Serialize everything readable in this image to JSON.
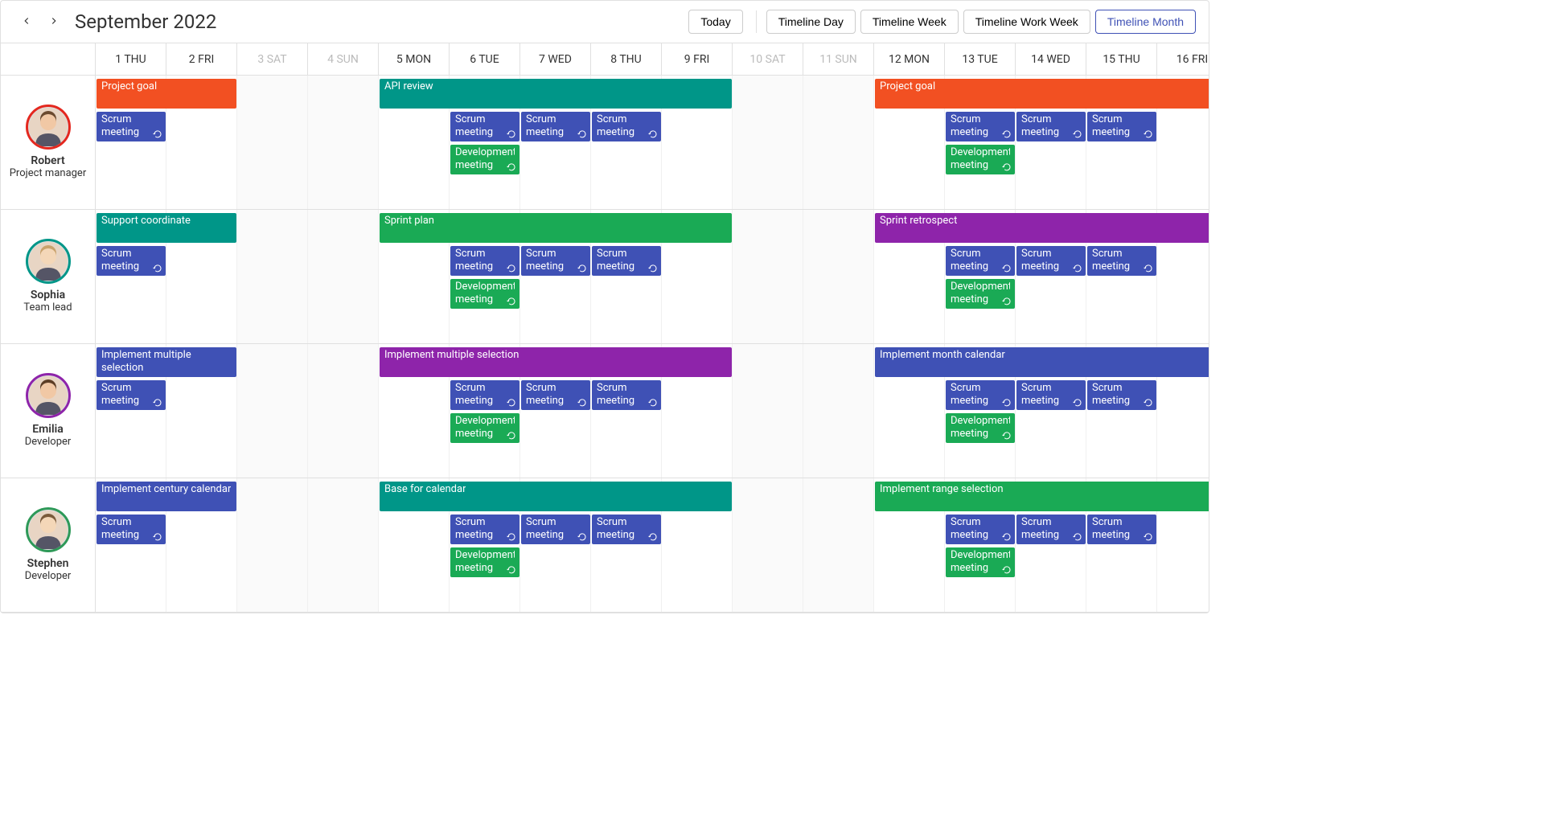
{
  "header": {
    "title": "September 2022",
    "today_label": "Today",
    "views": [
      {
        "label": "Timeline Day",
        "active": false
      },
      {
        "label": "Timeline Week",
        "active": false
      },
      {
        "label": "Timeline Work Week",
        "active": false
      },
      {
        "label": "Timeline Month",
        "active": true
      }
    ]
  },
  "dates": [
    {
      "day": 1,
      "dow": "THU",
      "weekend": false
    },
    {
      "day": 2,
      "dow": "FRI",
      "weekend": false
    },
    {
      "day": 3,
      "dow": "SAT",
      "weekend": true
    },
    {
      "day": 4,
      "dow": "SUN",
      "weekend": true
    },
    {
      "day": 5,
      "dow": "MON",
      "weekend": false
    },
    {
      "day": 6,
      "dow": "TUE",
      "weekend": false
    },
    {
      "day": 7,
      "dow": "WED",
      "weekend": false
    },
    {
      "day": 8,
      "dow": "THU",
      "weekend": false
    },
    {
      "day": 9,
      "dow": "FRI",
      "weekend": false
    },
    {
      "day": 10,
      "dow": "SAT",
      "weekend": true
    },
    {
      "day": 11,
      "dow": "SUN",
      "weekend": true
    },
    {
      "day": 12,
      "dow": "MON",
      "weekend": false
    },
    {
      "day": 13,
      "dow": "TUE",
      "weekend": false
    },
    {
      "day": 14,
      "dow": "WED",
      "weekend": false
    },
    {
      "day": 15,
      "dow": "THU",
      "weekend": false
    },
    {
      "day": 16,
      "dow": "FRI",
      "weekend": false
    }
  ],
  "resources": [
    {
      "name": "Robert",
      "role": "Project manager",
      "color": "#e4281f"
    },
    {
      "name": "Sophia",
      "role": "Team lead",
      "color": "#009688"
    },
    {
      "name": "Emilia",
      "role": "Developer",
      "color": "#8e24aa"
    },
    {
      "name": "Stephen",
      "role": "Developer",
      "color": "#2e9958"
    }
  ],
  "events": {
    "robert": [
      {
        "label": "Project goal",
        "start": 1,
        "end": 2,
        "row": 0,
        "color": "#f25022",
        "recur": false
      },
      {
        "label": "Scrum meeting",
        "start": 1,
        "end": 1,
        "row": 1,
        "color": "#3f51b5",
        "recur": true
      },
      {
        "label": "API review",
        "start": 5,
        "end": 9,
        "row": 0,
        "color": "#009688",
        "recur": false
      },
      {
        "label": "Scrum meeting",
        "start": 6,
        "end": 6,
        "row": 1,
        "color": "#3f51b5",
        "recur": true
      },
      {
        "label": "Scrum meeting",
        "start": 7,
        "end": 7,
        "row": 1,
        "color": "#3f51b5",
        "recur": true
      },
      {
        "label": "Scrum meeting",
        "start": 8,
        "end": 8,
        "row": 1,
        "color": "#3f51b5",
        "recur": true
      },
      {
        "label": "Development meeting",
        "start": 6,
        "end": 6,
        "row": 2,
        "color": "#1aaa55",
        "recur": true
      },
      {
        "label": "Project goal",
        "start": 12,
        "end": 16,
        "row": 0,
        "color": "#f25022",
        "recur": false,
        "openend": true
      },
      {
        "label": "Scrum meeting",
        "start": 13,
        "end": 13,
        "row": 1,
        "color": "#3f51b5",
        "recur": true
      },
      {
        "label": "Scrum meeting",
        "start": 14,
        "end": 14,
        "row": 1,
        "color": "#3f51b5",
        "recur": true
      },
      {
        "label": "Scrum meeting",
        "start": 15,
        "end": 15,
        "row": 1,
        "color": "#3f51b5",
        "recur": true
      },
      {
        "label": "Development meeting",
        "start": 13,
        "end": 13,
        "row": 2,
        "color": "#1aaa55",
        "recur": true
      }
    ],
    "sophia": [
      {
        "label": "Support coordinate",
        "start": 1,
        "end": 2,
        "row": 0,
        "color": "#009688",
        "recur": false
      },
      {
        "label": "Scrum meeting",
        "start": 1,
        "end": 1,
        "row": 1,
        "color": "#3f51b5",
        "recur": true
      },
      {
        "label": "Sprint plan",
        "start": 5,
        "end": 9,
        "row": 0,
        "color": "#1aaa55",
        "recur": false
      },
      {
        "label": "Scrum meeting",
        "start": 6,
        "end": 6,
        "row": 1,
        "color": "#3f51b5",
        "recur": true
      },
      {
        "label": "Scrum meeting",
        "start": 7,
        "end": 7,
        "row": 1,
        "color": "#3f51b5",
        "recur": true
      },
      {
        "label": "Scrum meeting",
        "start": 8,
        "end": 8,
        "row": 1,
        "color": "#3f51b5",
        "recur": true
      },
      {
        "label": "Development meeting",
        "start": 6,
        "end": 6,
        "row": 2,
        "color": "#1aaa55",
        "recur": true
      },
      {
        "label": "Sprint retrospect",
        "start": 12,
        "end": 16,
        "row": 0,
        "color": "#8e24aa",
        "recur": false,
        "openend": true
      },
      {
        "label": "Scrum meeting",
        "start": 13,
        "end": 13,
        "row": 1,
        "color": "#3f51b5",
        "recur": true
      },
      {
        "label": "Scrum meeting",
        "start": 14,
        "end": 14,
        "row": 1,
        "color": "#3f51b5",
        "recur": true
      },
      {
        "label": "Scrum meeting",
        "start": 15,
        "end": 15,
        "row": 1,
        "color": "#3f51b5",
        "recur": true
      },
      {
        "label": "Development meeting",
        "start": 13,
        "end": 13,
        "row": 2,
        "color": "#1aaa55",
        "recur": true
      }
    ],
    "emilia": [
      {
        "label": "Implement multiple selection",
        "start": 1,
        "end": 2,
        "row": 0,
        "color": "#3f51b5",
        "recur": false
      },
      {
        "label": "Scrum meeting",
        "start": 1,
        "end": 1,
        "row": 1,
        "color": "#3f51b5",
        "recur": true
      },
      {
        "label": "Implement multiple selection",
        "start": 5,
        "end": 9,
        "row": 0,
        "color": "#8e24aa",
        "recur": false
      },
      {
        "label": "Scrum meeting",
        "start": 6,
        "end": 6,
        "row": 1,
        "color": "#3f51b5",
        "recur": true
      },
      {
        "label": "Scrum meeting",
        "start": 7,
        "end": 7,
        "row": 1,
        "color": "#3f51b5",
        "recur": true
      },
      {
        "label": "Scrum meeting",
        "start": 8,
        "end": 8,
        "row": 1,
        "color": "#3f51b5",
        "recur": true
      },
      {
        "label": "Development meeting",
        "start": 6,
        "end": 6,
        "row": 2,
        "color": "#1aaa55",
        "recur": true
      },
      {
        "label": "Implement month calendar",
        "start": 12,
        "end": 16,
        "row": 0,
        "color": "#3f51b5",
        "recur": false,
        "openend": true
      },
      {
        "label": "Scrum meeting",
        "start": 13,
        "end": 13,
        "row": 1,
        "color": "#3f51b5",
        "recur": true
      },
      {
        "label": "Scrum meeting",
        "start": 14,
        "end": 14,
        "row": 1,
        "color": "#3f51b5",
        "recur": true
      },
      {
        "label": "Scrum meeting",
        "start": 15,
        "end": 15,
        "row": 1,
        "color": "#3f51b5",
        "recur": true
      },
      {
        "label": "Development meeting",
        "start": 13,
        "end": 13,
        "row": 2,
        "color": "#1aaa55",
        "recur": true
      }
    ],
    "stephen": [
      {
        "label": "Implement century calendar",
        "start": 1,
        "end": 2,
        "row": 0,
        "color": "#3f51b5",
        "recur": false
      },
      {
        "label": "Scrum meeting",
        "start": 1,
        "end": 1,
        "row": 1,
        "color": "#3f51b5",
        "recur": true
      },
      {
        "label": "Base for calendar",
        "start": 5,
        "end": 9,
        "row": 0,
        "color": "#009688",
        "recur": false
      },
      {
        "label": "Scrum meeting",
        "start": 6,
        "end": 6,
        "row": 1,
        "color": "#3f51b5",
        "recur": true
      },
      {
        "label": "Scrum meeting",
        "start": 7,
        "end": 7,
        "row": 1,
        "color": "#3f51b5",
        "recur": true
      },
      {
        "label": "Scrum meeting",
        "start": 8,
        "end": 8,
        "row": 1,
        "color": "#3f51b5",
        "recur": true
      },
      {
        "label": "Development meeting",
        "start": 6,
        "end": 6,
        "row": 2,
        "color": "#1aaa55",
        "recur": true
      },
      {
        "label": "Implement range selection",
        "start": 12,
        "end": 16,
        "row": 0,
        "color": "#1aaa55",
        "recur": false,
        "openend": true
      },
      {
        "label": "Scrum meeting",
        "start": 13,
        "end": 13,
        "row": 1,
        "color": "#3f51b5",
        "recur": true
      },
      {
        "label": "Scrum meeting",
        "start": 14,
        "end": 14,
        "row": 1,
        "color": "#3f51b5",
        "recur": true
      },
      {
        "label": "Scrum meeting",
        "start": 15,
        "end": 15,
        "row": 1,
        "color": "#3f51b5",
        "recur": true
      },
      {
        "label": "Development meeting",
        "start": 13,
        "end": 13,
        "row": 2,
        "color": "#1aaa55",
        "recur": true
      }
    ]
  }
}
